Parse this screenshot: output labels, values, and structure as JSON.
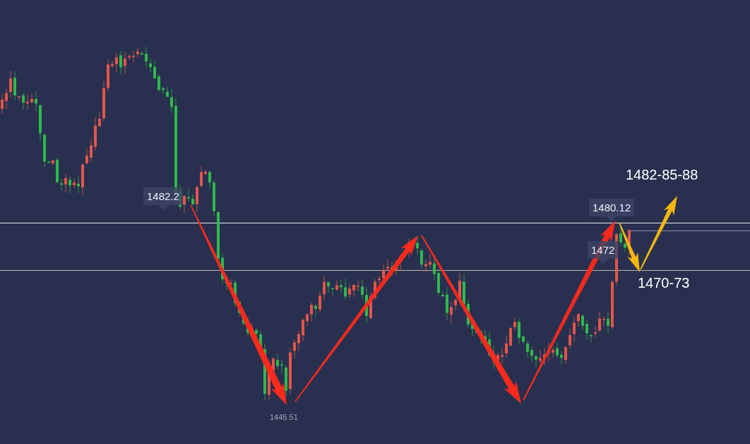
{
  "chart": {
    "price_tags": [
      {
        "text": "1482.2"
      },
      {
        "text": "1480.12"
      },
      {
        "text": "1472"
      }
    ],
    "low_label": "1445.51",
    "targets": [
      {
        "text": "1482-85-88"
      },
      {
        "text": "1470-73"
      }
    ]
  }
}
